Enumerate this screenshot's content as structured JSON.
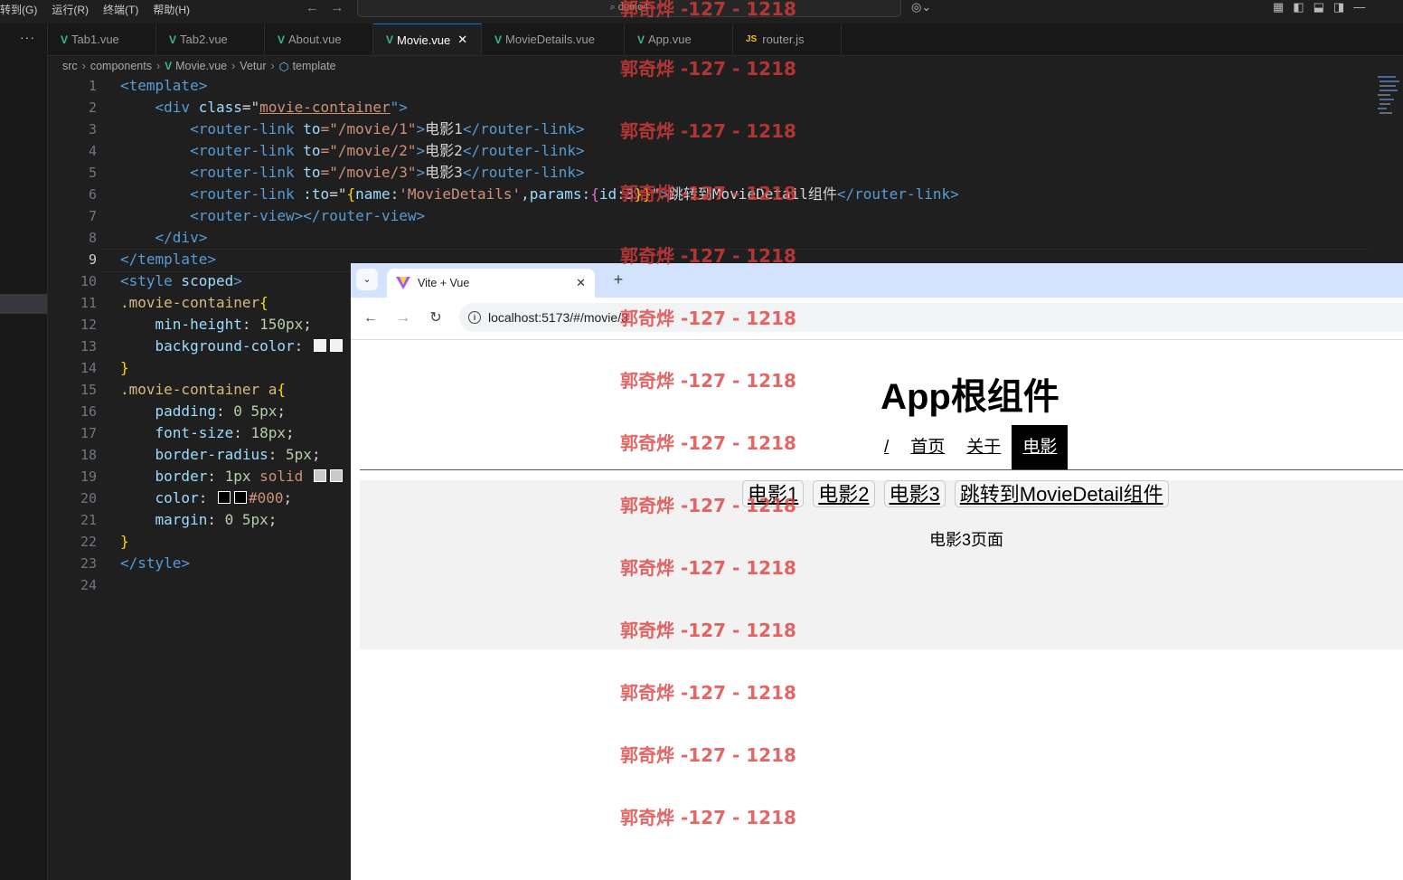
{
  "vscode": {
    "menu": [
      "转到(G)",
      "运行(R)",
      "终端(T)",
      "帮助(H)"
    ],
    "search_text": "demo4",
    "activity_dots": "···",
    "tabs": [
      {
        "label": "Tab1.vue",
        "type": "vue",
        "active": false
      },
      {
        "label": "Tab2.vue",
        "type": "vue",
        "active": false
      },
      {
        "label": "About.vue",
        "type": "vue",
        "active": false
      },
      {
        "label": "Movie.vue",
        "type": "vue",
        "active": true
      },
      {
        "label": "MovieDetails.vue",
        "type": "vue",
        "active": false
      },
      {
        "label": "App.vue",
        "type": "vue",
        "active": false
      },
      {
        "label": "router.js",
        "type": "js",
        "active": false
      }
    ],
    "breadcrumb": [
      "src",
      "components",
      "Movie.vue",
      "Vetur",
      "template"
    ],
    "line_numbers": [
      "1",
      "2",
      "3",
      "4",
      "5",
      "6",
      "7",
      "8",
      "9",
      "10",
      "11",
      "12",
      "13",
      "14",
      "15",
      "16",
      "17",
      "18",
      "19",
      "20",
      "21",
      "22",
      "23",
      "24"
    ],
    "current_line": 9,
    "code": {
      "l1_tag": "<template>",
      "l2_open": "<div",
      "l2_attr": " class",
      "l2_eq": "=\"",
      "l2_val": "movie-container",
      "l2_close": "\">",
      "l3_open": "<router-link",
      "l3_attr": " to",
      "l3_val": "=\"/movie/1\"",
      "l3_gt": ">",
      "l3_text": "电影1",
      "l3_end": "</router-link>",
      "l4_open": "<router-link",
      "l4_attr": " to",
      "l4_val": "=\"/movie/2\"",
      "l4_gt": ">",
      "l4_text": "电影2",
      "l4_end": "</router-link>",
      "l5_open": "<router-link",
      "l5_attr": " to",
      "l5_val": "=\"/movie/3\"",
      "l5_gt": ">",
      "l5_text": "电影3",
      "l5_end": "</router-link>",
      "l6_open": "<router-link",
      "l6_attr": " :to",
      "l6_eq": "=\"",
      "l6_b1": "{",
      "l6_k1": "name:",
      "l6_v1": "'MovieDetails'",
      "l6_k2": ",params:",
      "l6_b2": "{",
      "l6_k3": "id:3",
      "l6_b3": "}}",
      "l6_q": "\"",
      "l6_gt": ">",
      "l6_text": "跳转到MovieDetail组件",
      "l6_end": "</router-link>",
      "l7": "<router-view></router-view>",
      "l8": "</div>",
      "l9": "</template>",
      "l10_open": "<style",
      "l10_attr": " scoped",
      "l10_gt": ">",
      "l11_sel": ".movie-container",
      "l11_brace": "{",
      "l12_prop": "min-height",
      "l12_colon": ": ",
      "l12_val": "150px",
      "l12_semi": ";",
      "l13_prop": "background-color",
      "l13_colon": ": ",
      "l14": "}",
      "l15_sel": ".movie-container a",
      "l15_brace": "{",
      "l16_prop": "padding",
      "l16_colon": ": ",
      "l16_val": "0 5px",
      "l16_semi": ";",
      "l17_prop": "font-size",
      "l17_colon": ": ",
      "l17_val": "18px",
      "l17_semi": ";",
      "l18_prop": "border-radius",
      "l18_colon": ": ",
      "l18_val": "5px",
      "l18_semi": ";",
      "l19_prop": "border",
      "l19_colon": ": ",
      "l19_val": "1px",
      "l19_kw": " solid",
      "l20_prop": "color",
      "l20_colon": ": ",
      "l20_val": "#000",
      "l20_semi": ";",
      "l21_prop": "margin",
      "l21_colon": ": ",
      "l21_val": "0 5px",
      "l21_semi": ";",
      "l22": "}",
      "l23": "</style>"
    }
  },
  "browser": {
    "tab_title": "Vite + Vue",
    "new_tab": "+",
    "url": "localhost:5173/#/movie/3",
    "app_title": "App根组件",
    "nav": [
      {
        "label": "/",
        "active": false
      },
      {
        "label": "首页",
        "active": false
      },
      {
        "label": "关于",
        "active": false
      },
      {
        "label": "电影",
        "active": true
      }
    ],
    "movie_links": [
      "电影1",
      "电影2",
      "电影3",
      "跳转到MovieDetail组件"
    ],
    "movie_page_text": "电影3页面"
  },
  "watermark": "郭奇烨 -127 - 1218",
  "colors": {
    "vue_green": "#41b883",
    "accent_blue": "#0078d4",
    "watermark_red": "#dc3c3c"
  }
}
